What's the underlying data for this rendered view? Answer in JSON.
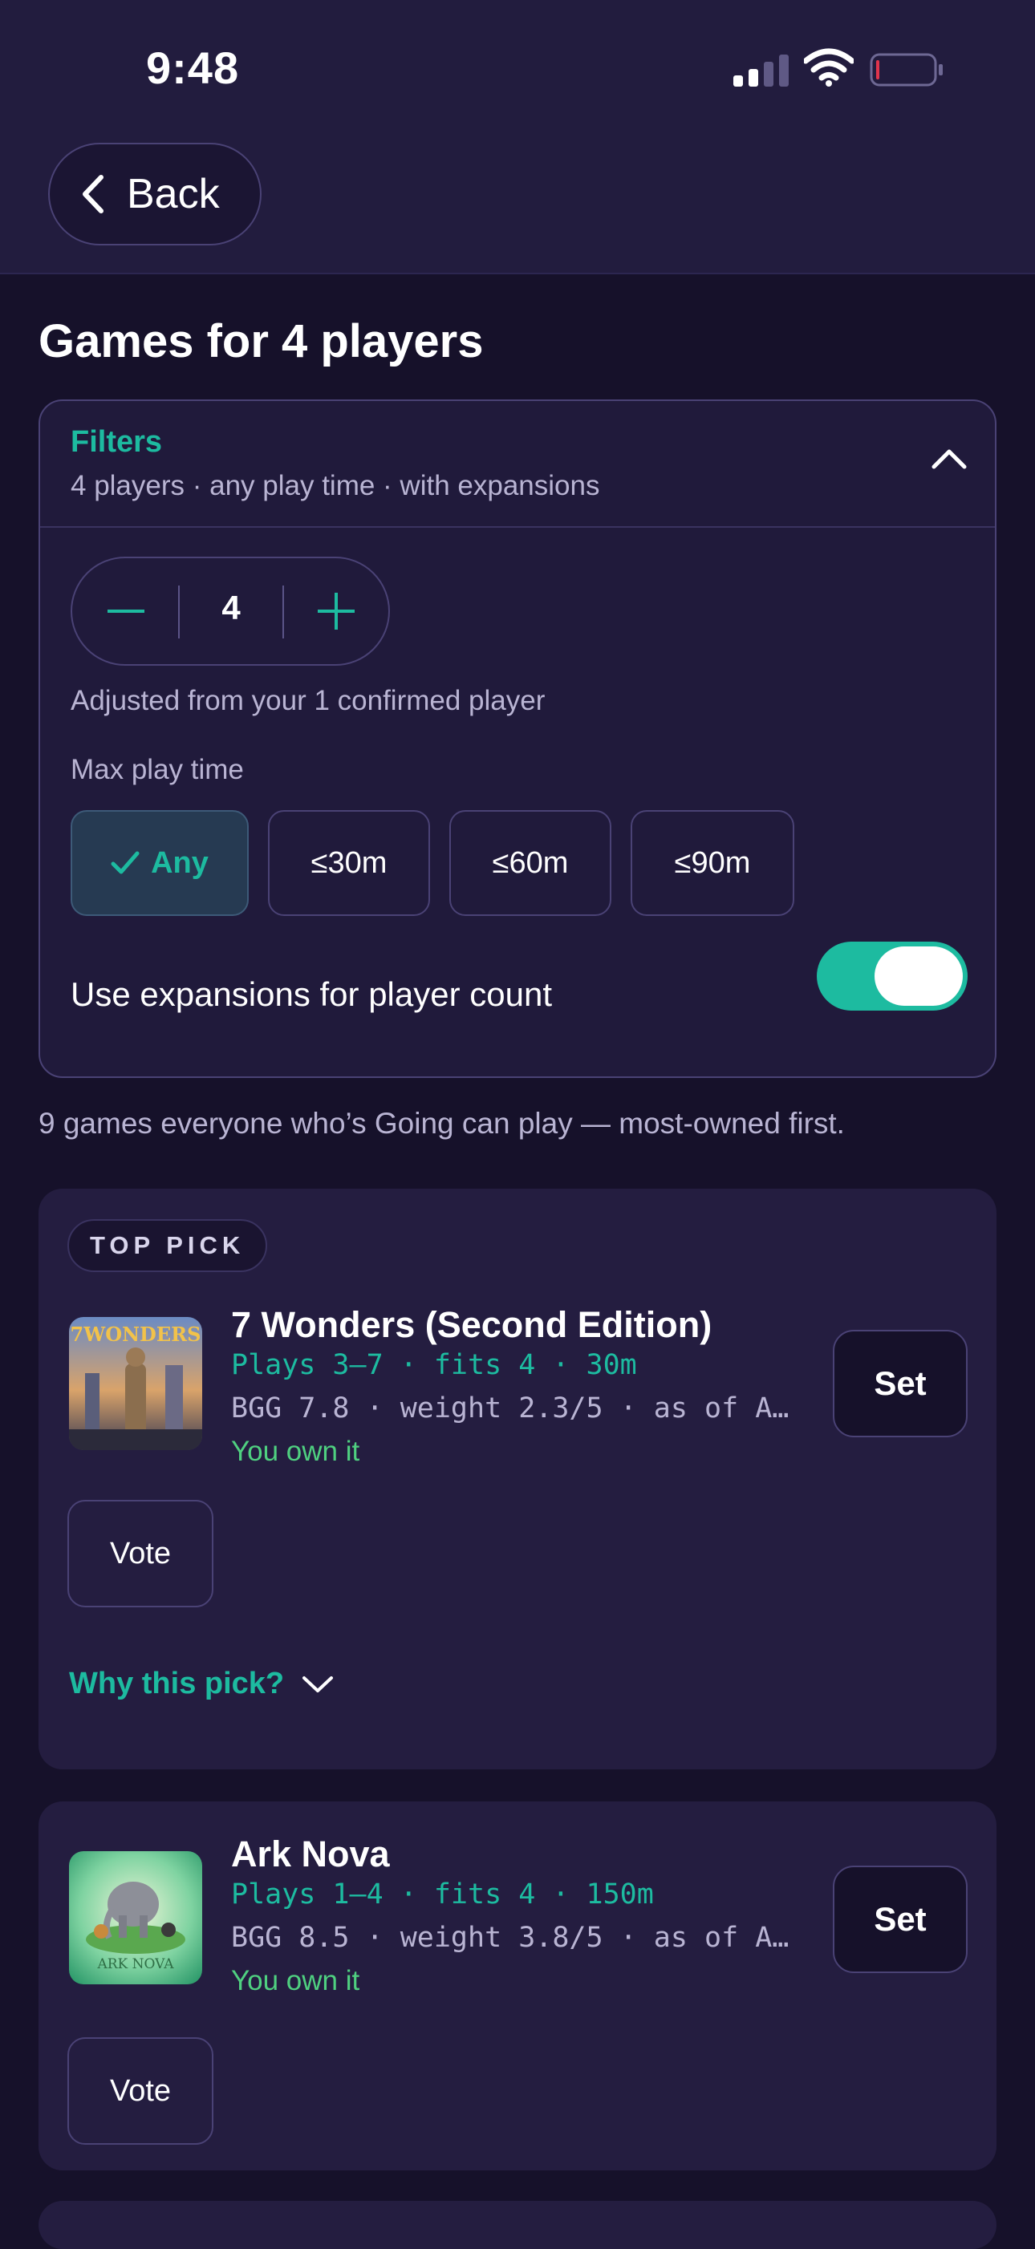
{
  "status_bar": {
    "time": "9:48",
    "icons": [
      "cellular-signal-icon",
      "wifi-icon",
      "battery-low-icon"
    ]
  },
  "nav": {
    "back_label": "Back"
  },
  "page": {
    "title": "Games for 4 players"
  },
  "filters": {
    "title": "Filters",
    "summary": "4 players · any play time · with expansions",
    "expanded": true,
    "player_count": "4",
    "adjusted_note": "Adjusted from your 1 confirmed player",
    "max_play_time_label": "Max play time",
    "play_time_options": [
      {
        "label": "Any",
        "selected": true
      },
      {
        "label": "≤30m",
        "selected": false
      },
      {
        "label": "≤60m",
        "selected": false
      },
      {
        "label": "≤90m",
        "selected": false
      }
    ],
    "expansions_label": "Use expansions for player count",
    "expansions_enabled": true
  },
  "results": {
    "note": "9 games everyone who’s Going can play — most-owned first.",
    "games": [
      {
        "badge": "TOP PICK",
        "title": "7 Wonders (Second Edition)",
        "meta": "Plays 3–7 · fits 4 · 30m",
        "bgg": "BGG 7.8 · weight 2.3/5 · as of A…",
        "ownership": "You own it",
        "set_label": "Set",
        "vote_label": "Vote",
        "why_label": "Why this pick?",
        "cover_text": "7WONDERS"
      },
      {
        "title": "Ark Nova",
        "meta": "Plays 1–4 · fits 4 · 150m",
        "bgg": "BGG 8.5 · weight 3.8/5 · as of A…",
        "ownership": "You own it",
        "set_label": "Set",
        "vote_label": "Vote",
        "cover_text": "ARK NOVA"
      }
    ]
  },
  "colors": {
    "background": "#16112a",
    "header": "#221c3e",
    "card": "#241d40",
    "accent": "#1dbba0",
    "owned": "#4fd080",
    "muted_text": "#b9b4d3"
  }
}
